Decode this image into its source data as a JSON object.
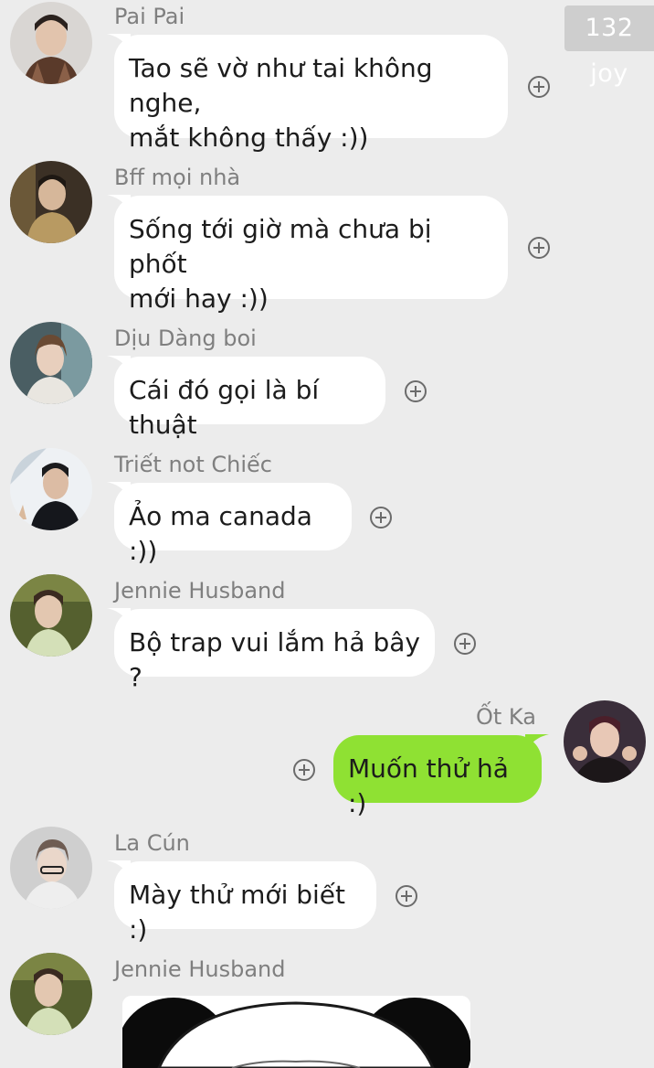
{
  "watermark": "132 joy",
  "messages": [
    {
      "sender": "Pai Pai",
      "text": "Tao sẽ vờ như tai không nghe,\nmắt không thấy :))",
      "avatar": "avatar-pai-pai"
    },
    {
      "sender": "Bff mọi nhà",
      "text": "Sống tới giờ mà chưa bị phốt\nmới hay :))",
      "avatar": "avatar-bff-moi-nha"
    },
    {
      "sender": "Dịu Dàng boi",
      "text": "Cái đó gọi là bí thuật",
      "avatar": "avatar-diu-dang-boi"
    },
    {
      "sender": "Triết not Chiếc",
      "text": "Ảo ma canada :))",
      "avatar": "avatar-triet-not-chiec"
    },
    {
      "sender": "Jennie Husband",
      "text": "Bộ trap vui lắm hả bây ?",
      "avatar": "avatar-jennie-husband"
    },
    {
      "sender": "Ốt Ka",
      "text": "Muốn thử hả :)",
      "avatar": "avatar-ot-ka",
      "outgoing": true
    },
    {
      "sender": "La Cún",
      "text": "Mày thử mới biết :)",
      "avatar": "avatar-la-cun"
    },
    {
      "sender": "Jennie Husband",
      "text": "",
      "avatar": "avatar-jennie-husband",
      "attachment": "panda-meme-image"
    }
  ],
  "colors": {
    "background": "#ececec",
    "incoming_bubble": "#ffffff",
    "outgoing_bubble": "#8fe133",
    "sender_name": "#7f7f7f"
  },
  "icons": {
    "add_reaction": "plus-circle-icon"
  }
}
